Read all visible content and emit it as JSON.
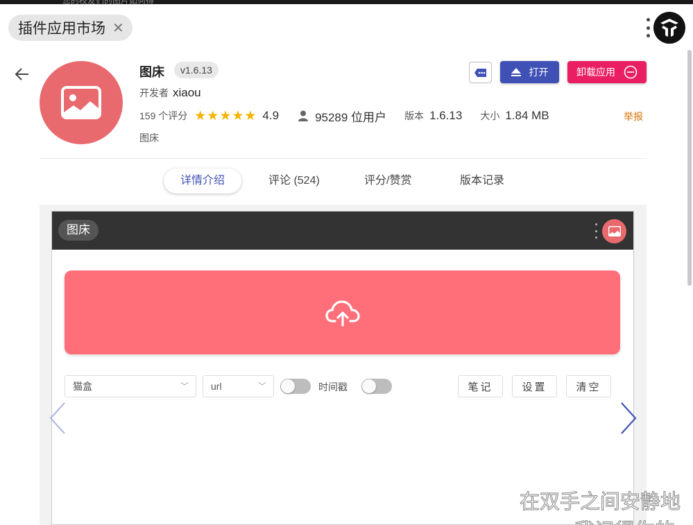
{
  "window": {
    "tab_title": "插件应用市场",
    "background_tab_text": "您的校友们的图片如何得"
  },
  "app": {
    "name": "图床",
    "version_badge": "v1.6.13",
    "developer_label": "开发者",
    "developer": "xiaou",
    "rating_count": "159 个评分",
    "rating": "4.9",
    "stars_text": "★★★★★",
    "users": "95289 位用户",
    "version_label": "版本",
    "version": "1.6.13",
    "size_label": "大小",
    "size": "1.84 MB",
    "report": "举报",
    "category": "图床",
    "open_label": "打开",
    "uninstall_label": "卸载应用"
  },
  "tabs": [
    {
      "label": "详情介绍",
      "active": true
    },
    {
      "label": "评论 (524)",
      "active": false
    },
    {
      "label": "评分/赞赏",
      "active": false
    },
    {
      "label": "版本记录",
      "active": false
    }
  ],
  "preview": {
    "title": "图床",
    "host_select": "猫盒",
    "format_select": "url",
    "timestamp_label": "时间戳",
    "btn_notes": "笔记",
    "btn_settings": "设置",
    "btn_clear": "清空"
  },
  "overlay": {
    "lyric_line1": "在双手之间安静地",
    "lyric_line2": "我记得你的"
  },
  "colors": {
    "primary": "#3f51b5",
    "danger": "#e91e63",
    "accent_red": "#e96a6e",
    "upload": "#ff6f7a",
    "star": "#f5b400",
    "report": "#d8760a"
  }
}
